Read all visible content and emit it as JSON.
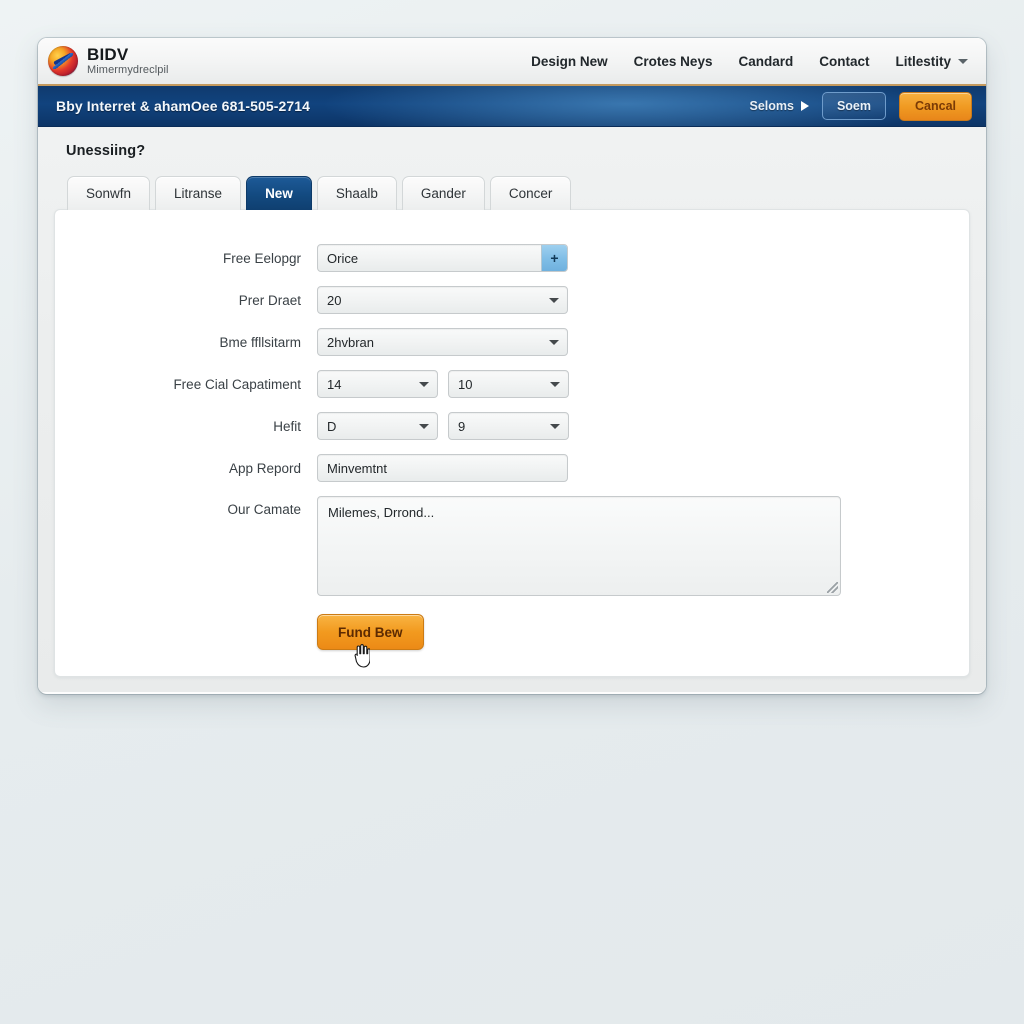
{
  "header": {
    "logo_icon": "bidv-circle-logo-icon",
    "brand_name": "BIDV",
    "brand_tagline": "Mimermydreclpil",
    "nav": [
      {
        "label": "Design New",
        "caret": false
      },
      {
        "label": "Crotes Neys",
        "caret": false
      },
      {
        "label": "Candard",
        "caret": false
      },
      {
        "label": "Contact",
        "caret": false
      },
      {
        "label": "Litlestity",
        "caret": true
      }
    ]
  },
  "banner": {
    "text": "Bby Interret & ahamOee 681-505-2714",
    "link_label": "Seloms",
    "link_icon": "triangle-right-icon",
    "ghost_button": "Soem",
    "orange_button": "Cancal"
  },
  "page": {
    "title": "Unessiing?"
  },
  "tabs": [
    {
      "label": "Sonwfn",
      "active": false
    },
    {
      "label": "Litranse",
      "active": false
    },
    {
      "label": "New",
      "active": true
    },
    {
      "label": "Shaalb",
      "active": false
    },
    {
      "label": "Gander",
      "active": false
    },
    {
      "label": "Concer",
      "active": false
    }
  ],
  "form": {
    "rows": [
      {
        "label": "Free Eelopgr",
        "type": "text-addon",
        "value": "Orice",
        "addon_label": "+",
        "addon_icon": "plus-icon"
      },
      {
        "label": "Prer Draet",
        "type": "select",
        "value": "20"
      },
      {
        "label": "Bme ffllsitarm",
        "type": "select",
        "value": "2hvbran"
      },
      {
        "label": "Free Cial Capatiment",
        "type": "select-pair",
        "value": "14",
        "value2": "10"
      },
      {
        "label": "Hefit",
        "type": "select-pair",
        "value": "D",
        "value2": "9"
      },
      {
        "label": "App Repord",
        "type": "text",
        "value": "Minvemtnt"
      },
      {
        "label": "Our Camate",
        "type": "textarea",
        "value": "Milemes, Drrond..."
      }
    ],
    "submit_label": "Fund Bew"
  },
  "colors": {
    "banner_blue": "#11437e",
    "tab_active_blue": "#134a80",
    "accent_orange": "#f29a1f",
    "addon_blue": "#7fbde6",
    "page_bg": "#e7ecee",
    "brand_gold_rule": "#c49a5e"
  }
}
